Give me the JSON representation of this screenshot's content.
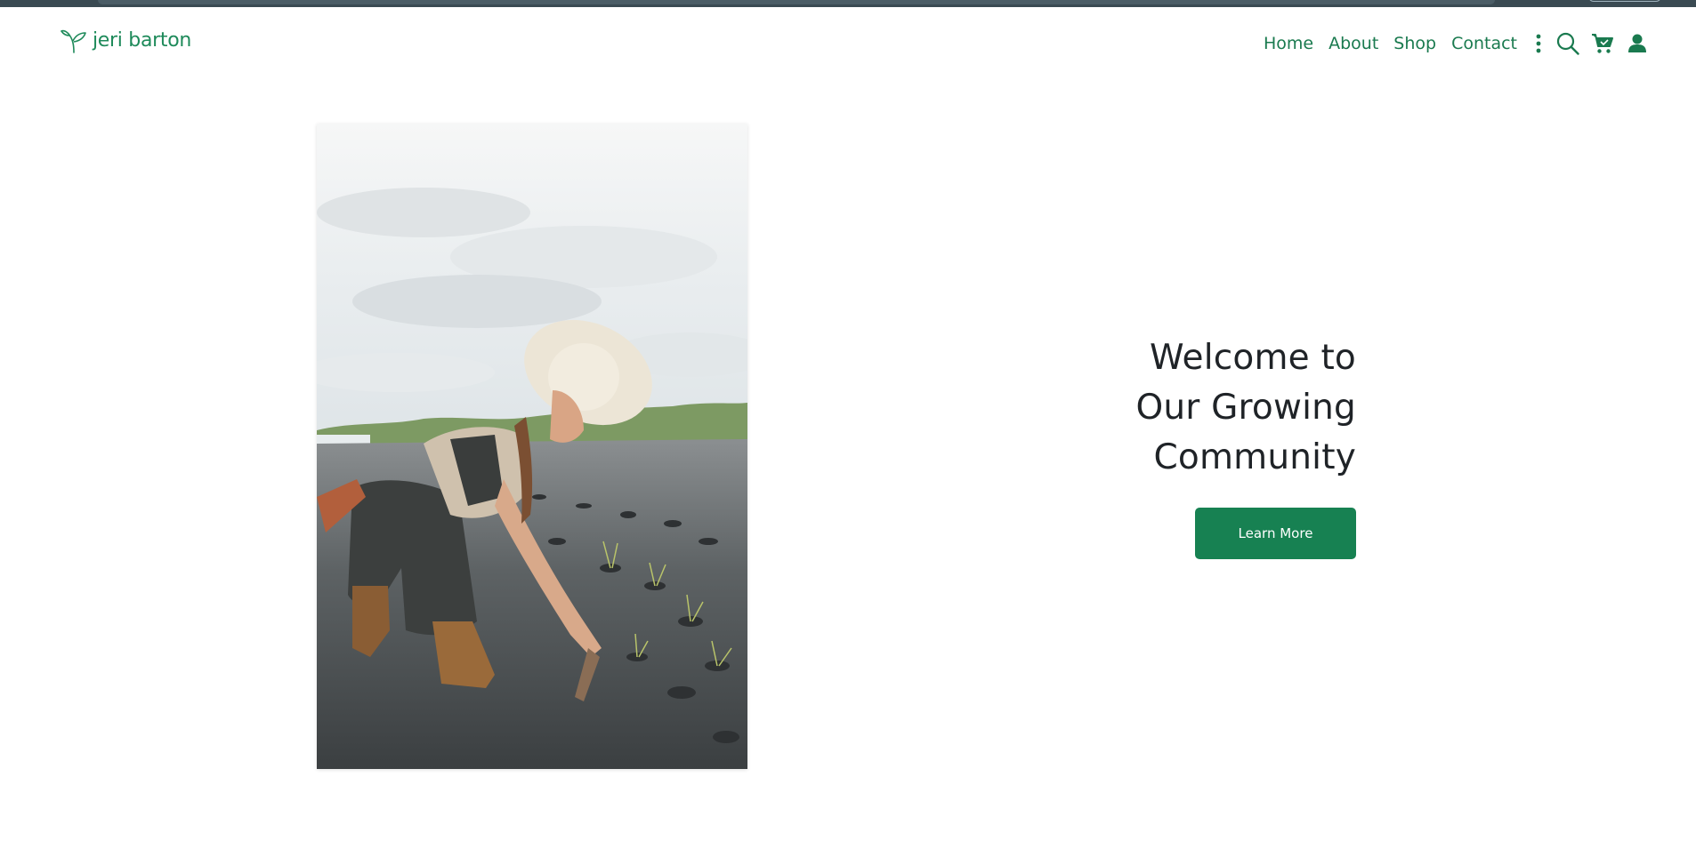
{
  "brand": {
    "name": "jeri barton",
    "icon": "sprout-icon"
  },
  "nav": {
    "links": [
      {
        "id": "home",
        "label": "Home"
      },
      {
        "id": "about",
        "label": "About"
      },
      {
        "id": "shop",
        "label": "Shop"
      },
      {
        "id": "contact",
        "label": "Contact"
      }
    ],
    "icons": [
      "more-vertical-icon",
      "search-icon",
      "cart-icon",
      "user-icon"
    ]
  },
  "hero": {
    "title_line1": "Welcome to",
    "title_line2": "Our Growing",
    "title_line3": "Community",
    "button_label": "Learn More",
    "image_subject": "farmer-planting-seedlings"
  },
  "colors": {
    "brand_green": "#1e8a5a",
    "button_green": "#178152",
    "heading": "#1f2327",
    "browser_bar": "#3a4a52"
  }
}
